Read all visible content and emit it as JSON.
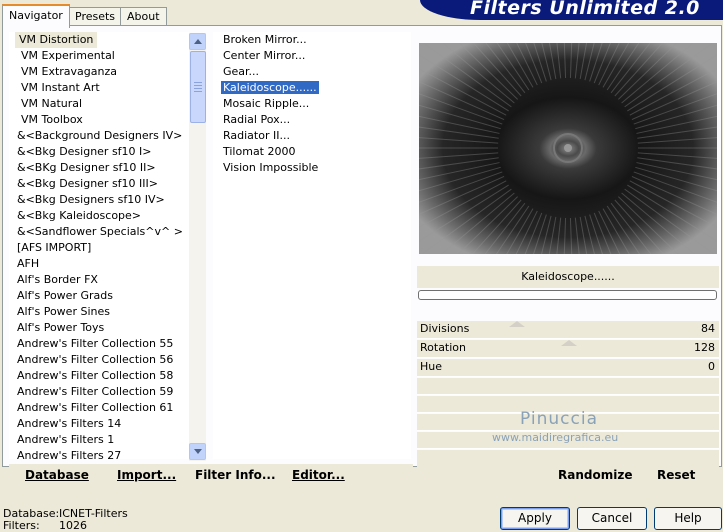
{
  "tabs": [
    {
      "label": "Navigator",
      "active": true
    },
    {
      "label": "Presets",
      "active": false
    },
    {
      "label": "About",
      "active": false
    }
  ],
  "banner_title": "Filters Unlimited 2.0",
  "categories": [
    "VM Distortion",
    "VM Experimental",
    "VM Extravaganza",
    "VM Instant Art",
    "VM Natural",
    "VM Toolbox",
    "&<Background Designers IV>",
    "&<Bkg Designer sf10 I>",
    "&<BKg Designer sf10 II>",
    "&<Bkg Designer sf10 III>",
    "&<Bkg Designers sf10 IV>",
    "&<Bkg Kaleidoscope>",
    "&<Sandflower Specials^v^ >",
    "[AFS IMPORT]",
    "AFH",
    "Alf's Border FX",
    "Alf's Power Grads",
    "Alf's Power Sines",
    "Alf's Power Toys",
    "Andrew's Filter Collection 55",
    "Andrew's Filter Collection 56",
    "Andrew's Filter Collection 58",
    "Andrew's Filter Collection 59",
    "Andrew's Filter Collection 61",
    "Andrew's Filters 14",
    "Andrew's Filters 1",
    "Andrew's Filters 27"
  ],
  "selected_category": "VM Distortion",
  "filters": [
    "Broken Mirror...",
    "Center Mirror...",
    "Gear...",
    "Kaleidoscope......",
    "Mosaic Ripple...",
    "Radial Pox...",
    "Radiator II...",
    "Tilomat 2000",
    "Vision Impossible"
  ],
  "selected_filter": "Kaleidoscope......",
  "filter_name_display": "Kaleidoscope......",
  "params": [
    {
      "label": "Divisions",
      "value": "84"
    },
    {
      "label": "Rotation",
      "value": "128"
    },
    {
      "label": "Hue",
      "value": "0"
    }
  ],
  "watermark": {
    "name": "Pinuccia",
    "site": "www.maidiregrafica.eu"
  },
  "left_buttons": {
    "database": "Database",
    "import": "Import...",
    "filter_info": "Filter Info...",
    "editor": "Editor..."
  },
  "right_buttons": {
    "randomize": "Randomize",
    "reset": "Reset"
  },
  "status": {
    "database_label": "Database:",
    "database_value": "ICNET-Filters",
    "filters_label": "Filters:",
    "filters_value": "1026"
  },
  "dialog_buttons": {
    "apply": "Apply",
    "cancel": "Cancel",
    "help": "Help"
  },
  "colors": {
    "banner": "#0a1a7a",
    "selection": "#316ac5",
    "tab_highlight": "#e68b2c"
  }
}
